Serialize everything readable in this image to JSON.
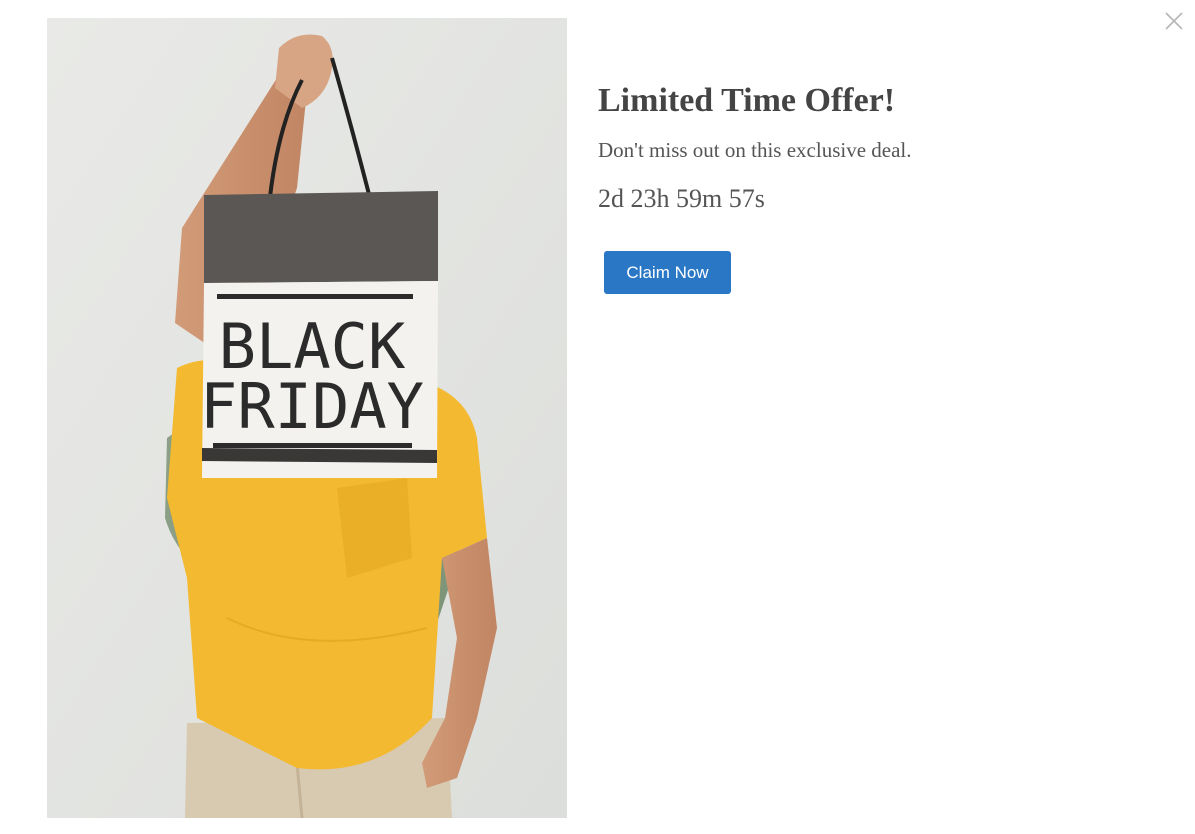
{
  "offer": {
    "title": "Limited Time Offer!",
    "subtitle": "Don't miss out on this exclusive deal.",
    "countdown": "2d 23h 59m 57s",
    "cta_label": "Claim Now"
  },
  "image": {
    "bag_text_line1": "BLACK",
    "bag_text_line2": "FRIDAY"
  },
  "colors": {
    "accent": "#2a78c5",
    "title": "#444444",
    "body_text": "#555555",
    "shirt": "#f3b931",
    "sweater": "#8a9f85",
    "bag_top": "#5a5755",
    "backdrop": "#e6e7e4"
  },
  "icons": {
    "close": "close-icon"
  }
}
